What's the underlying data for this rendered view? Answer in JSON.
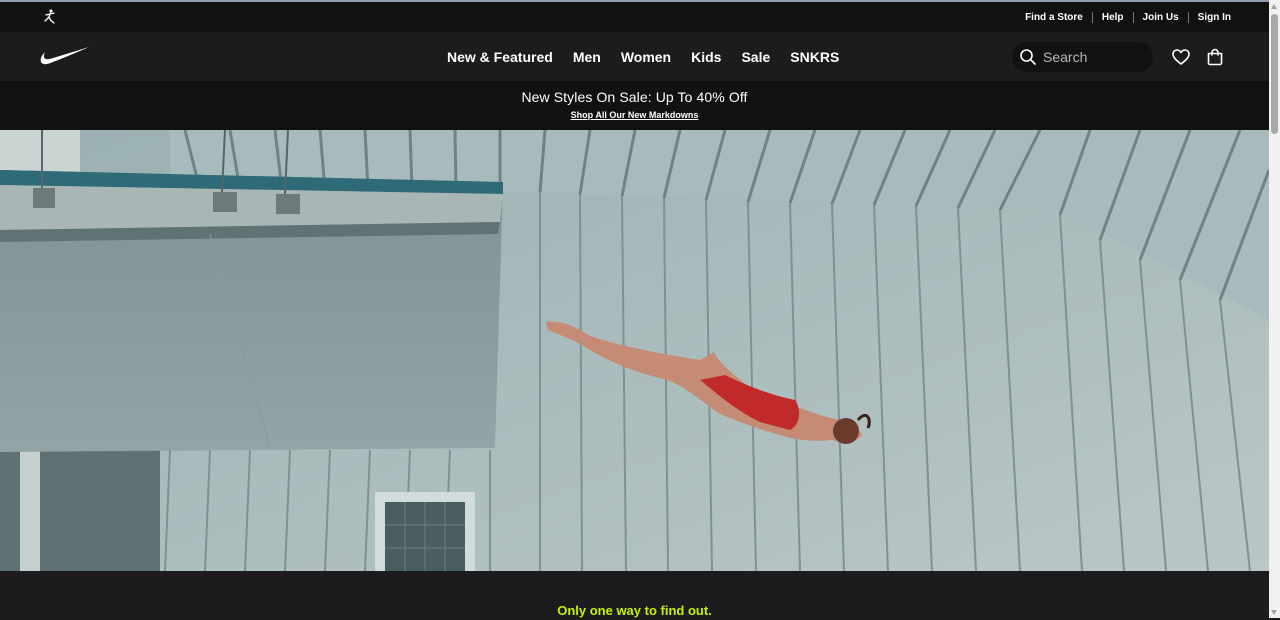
{
  "utility_bar": {
    "logo_icon": "jordan-jumpman-icon",
    "links": [
      "Find a Store",
      "Help",
      "Join Us",
      "Sign In"
    ]
  },
  "header": {
    "logo_icon": "nike-swoosh-icon",
    "nav": [
      "New & Featured",
      "Men",
      "Women",
      "Kids",
      "Sale",
      "SNKRS"
    ],
    "search_placeholder": "Search",
    "search_icon": "search-icon",
    "favorites_icon": "heart-icon",
    "bag_icon": "shopping-bag-icon"
  },
  "promo": {
    "headline": "New Styles On Sale: Up To 40% Off",
    "link": "Shop All Our New Markdowns"
  },
  "hero": {
    "image_icon": "diver-photo"
  },
  "section": {
    "tagline": "Only one way to find out."
  },
  "colors": {
    "background": "#1c1c1e",
    "bar": "#111111",
    "accent": "#c4f100"
  }
}
